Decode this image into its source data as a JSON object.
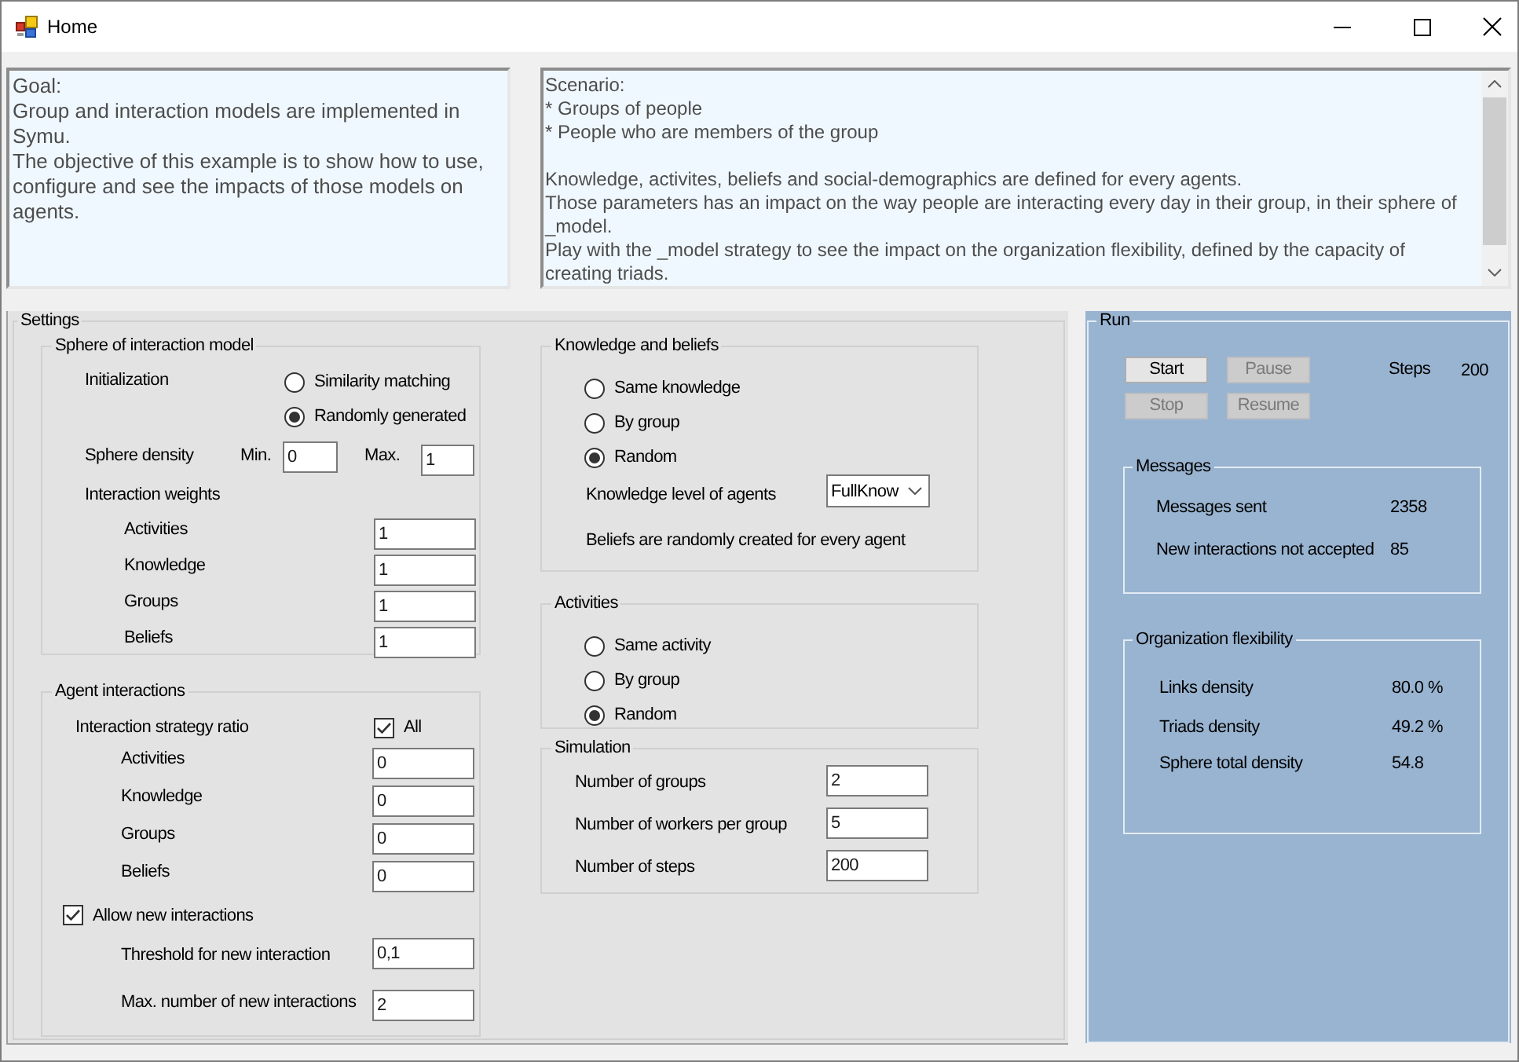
{
  "window": {
    "title": "Home"
  },
  "goal": {
    "paragraphs": [
      "Goal:",
      "Group and interaction models are implemented in Symu.",
      "The objective of this example is to show how to use, configure and see the impacts of those models on agents."
    ]
  },
  "scenario": {
    "blocks": [
      [
        "Scenario:",
        "* Groups of people",
        "* People who are members of the group"
      ],
      [
        "Knowledge, activites, beliefs and social-demographics are defined for every agents.",
        "Those parameters has an impact on the way people are interacting every day in their group, in their sphere of _model.",
        "Play with the _model strategy to see the impact on the organization flexibility, defined by the capacity of creating triads."
      ]
    ]
  },
  "settings": {
    "title": "Settings",
    "sphere_model": {
      "title": "Sphere of interaction model",
      "initialization_label": "Initialization",
      "initialization_options": [
        {
          "label": "Similarity matching",
          "selected": false
        },
        {
          "label": "Randomly generated",
          "selected": true
        }
      ],
      "density_label": "Sphere density",
      "min_label": "Min.",
      "min_value": "0",
      "max_label": "Max.",
      "max_value": "1",
      "weights_label": "Interaction weights",
      "weights": [
        {
          "label": "Activities",
          "value": "1"
        },
        {
          "label": "Knowledge",
          "value": "1"
        },
        {
          "label": "Groups",
          "value": "1"
        },
        {
          "label": "Beliefs",
          "value": "1"
        }
      ]
    },
    "agent_interactions": {
      "title": "Agent interactions",
      "ratio_label": "Interaction strategy ratio",
      "all_option": {
        "label": "All",
        "checked": true
      },
      "ratios": [
        {
          "label": "Activities",
          "value": "0"
        },
        {
          "label": "Knowledge",
          "value": "0"
        },
        {
          "label": "Groups",
          "value": "0"
        },
        {
          "label": "Beliefs",
          "value": "0"
        }
      ],
      "allow_new": {
        "label": "Allow new interactions",
        "checked": true
      },
      "threshold": {
        "label": "Threshold for new interaction",
        "value": "0,1"
      },
      "max_new": {
        "label": "Max. number of new interactions",
        "value": "2"
      }
    },
    "knowledge_beliefs": {
      "title": "Knowledge and beliefs",
      "options": [
        {
          "label": "Same knowledge",
          "selected": false
        },
        {
          "label": "By group",
          "selected": false
        },
        {
          "label": "Random",
          "selected": true
        }
      ],
      "level": {
        "label": "Knowledge level of agents",
        "value": "FullKnow"
      },
      "note": "Beliefs are randomly created for every agent"
    },
    "activities": {
      "title": "Activities",
      "options": [
        {
          "label": "Same activity",
          "selected": false
        },
        {
          "label": "By group",
          "selected": false
        },
        {
          "label": "Random",
          "selected": true
        }
      ]
    },
    "simulation": {
      "title": "Simulation",
      "fields": [
        {
          "label": "Number of groups",
          "value": "2"
        },
        {
          "label": "Number of workers per group",
          "value": "5"
        },
        {
          "label": "Number of steps",
          "value": "200"
        }
      ]
    }
  },
  "run": {
    "title": "Run",
    "buttons": [
      {
        "label": "Start",
        "disabled": false
      },
      {
        "label": "Pause",
        "disabled": true
      },
      {
        "label": "Stop",
        "disabled": true
      },
      {
        "label": "Resume",
        "disabled": true
      }
    ],
    "steps": {
      "label": "Steps",
      "value": "200"
    },
    "messages": {
      "title": "Messages",
      "rows": [
        {
          "label": "Messages sent",
          "value": "2358"
        },
        {
          "label": "New interactions not accepted",
          "value": "85"
        }
      ]
    },
    "flexibility": {
      "title": "Organization flexibility",
      "rows": [
        {
          "label": "Links density",
          "value": "80.0 %"
        },
        {
          "label": "Triads density",
          "value": "49.2 %"
        },
        {
          "label": "Sphere total density",
          "value": "54.8"
        }
      ]
    }
  }
}
